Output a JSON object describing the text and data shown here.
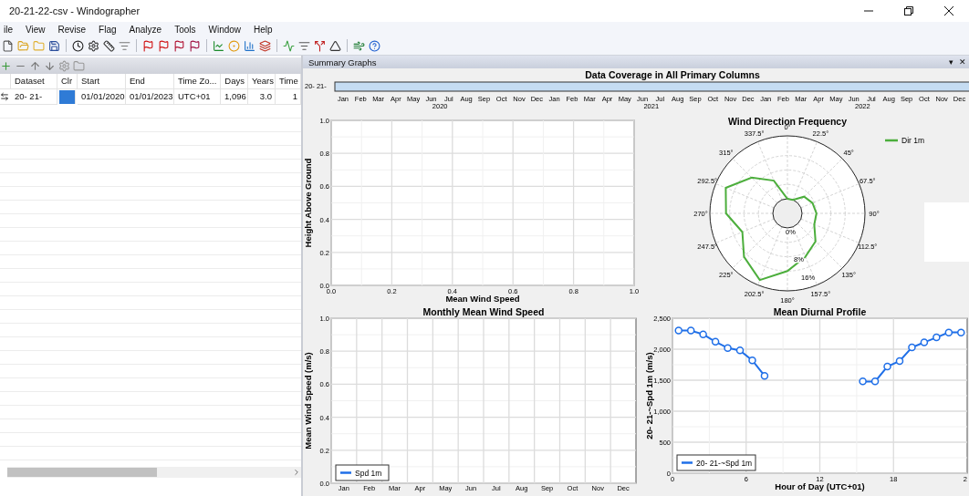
{
  "window": {
    "title": "20-21-22-csv - Windographer"
  },
  "menu": [
    "ile",
    "View",
    "Revise",
    "Flag",
    "Analyze",
    "Tools",
    "Window",
    "Help"
  ],
  "dataset_table": {
    "columns": [
      "Dataset",
      "Clr",
      "Start",
      "End",
      "Time Zo...",
      "Days",
      "Years",
      "Time"
    ],
    "rows": [
      {
        "dataset": "20- 21-",
        "color": "#2f7bd6",
        "start": "01/01/2020",
        "end": "01/01/2023",
        "time_zone": "UTC+01",
        "days": "1,096",
        "years": "3.0",
        "column_8": "1"
      }
    ]
  },
  "summary_graphs": {
    "title": "Summary Graphs",
    "controls": [
      "▾",
      "✕"
    ],
    "coverage": {
      "title": "Data Coverage in All Primary Columns",
      "rows": [
        {
          "label": "20- 21-",
          "level": 1
        }
      ],
      "months": [
        "Jan",
        "Feb",
        "Mar",
        "Apr",
        "May",
        "Jun",
        "Jul",
        "Aug",
        "Sep",
        "Oct",
        "Nov",
        "Dec",
        "Jan",
        "Feb",
        "Mar",
        "Apr",
        "May",
        "Jun",
        "Jul",
        "Aug",
        "Sep",
        "Oct",
        "Nov",
        "Dec",
        "Jan",
        "Feb",
        "Mar",
        "Apr",
        "May",
        "Jun",
        "Jul",
        "Aug",
        "Sep",
        "Oct",
        "Nov",
        "Dec"
      ],
      "years": [
        "2020",
        "2021",
        "2022"
      ]
    },
    "height_profile": {
      "chart_data": {
        "type": "line",
        "grid": true,
        "xlabel": "Mean Wind Speed",
        "ylabel": "Height Above Ground",
        "xlim": [
          0,
          1
        ],
        "ylim": [
          0,
          1
        ],
        "xticks": [
          {
            "value": 0,
            "label": "0.0"
          },
          {
            "value": 0.2,
            "label": "0.2"
          },
          {
            "value": 0.4,
            "label": "0.4"
          },
          {
            "value": 0.6,
            "label": "0.6"
          },
          {
            "value": 0.8,
            "label": "0.8"
          },
          {
            "value": 1,
            "label": "1.0"
          }
        ],
        "yticks": [
          {
            "value": 0,
            "label": "0.0"
          },
          {
            "value": 0.2,
            "label": "0.2"
          },
          {
            "value": 0.4,
            "label": "0.4"
          },
          {
            "value": 0.6,
            "label": "0.6"
          },
          {
            "value": 0.8,
            "label": "0.8"
          },
          {
            "value": 1,
            "label": "1.0"
          }
        ]
      }
    },
    "wind_direction": {
      "title": "Wind Direction Frequency",
      "directions": [
        "0°",
        "22.5°",
        "45°",
        "67.5°",
        "90°",
        "112.5°",
        "135°",
        "157.5°",
        "180°",
        "202.5°",
        "225°",
        "247.5°",
        "270°",
        "292.5°",
        "315°",
        "337.5°"
      ],
      "legend": [
        {
          "name": "Dir 1m",
          "color": "#4cae3c"
        }
      ],
      "ring_labels": [
        "0%",
        "8%",
        "16%"
      ]
    },
    "monthly": {
      "chart_data": {
        "type": "line",
        "grid": true,
        "title": "Monthly Mean Wind Speed",
        "ylabel": "Mean Wind Speed (m/s)",
        "categories": [
          "Jan",
          "Feb",
          "Mar",
          "Apr",
          "May",
          "Jun",
          "Jul",
          "Aug",
          "Sep",
          "Oct",
          "Nov",
          "Dec"
        ],
        "series": [
          {
            "name": "Spd 1m",
            "color": "#1f6fe8",
            "values": [
              null,
              null,
              null,
              null,
              null,
              null,
              null,
              null,
              null,
              null,
              null,
              null
            ]
          }
        ],
        "ylim": [
          0,
          1
        ],
        "yticks": [
          {
            "value": 0,
            "label": "0.0"
          },
          {
            "value": 0.2,
            "label": "0.2"
          },
          {
            "value": 0.4,
            "label": "0.4"
          },
          {
            "value": 0.6,
            "label": "0.6"
          },
          {
            "value": 0.8,
            "label": "0.8"
          },
          {
            "value": 1,
            "label": "1.0"
          }
        ]
      }
    },
    "diurnal": {
      "chart_data": {
        "type": "line",
        "grid": true,
        "title": "Mean Diurnal Profile",
        "xlabel": "Hour of Day (UTC+01)",
        "ylabel": "20- 21-~Spd 1m (m/s)",
        "x": [
          0.5,
          1.5,
          2.5,
          3.5,
          4.5,
          5.5,
          6.5,
          7.5,
          8.5,
          9.5,
          10.5,
          11.5,
          12.5,
          13.5,
          14.5,
          15.5,
          16.5,
          17.5,
          18.5,
          19.5,
          20.5,
          21.5,
          22.5,
          23.5
        ],
        "series": [
          {
            "name": "20- 21-~Spd 1m",
            "color": "#1f6fe8",
            "marker": true,
            "values": [
              2300,
              2300,
              2240,
              2120,
              2020,
              1980,
              1820,
              1570,
              null,
              null,
              null,
              null,
              null,
              null,
              null,
              1480,
              1480,
              1720,
              1810,
              2030,
              2110,
              2190,
              2270,
              2270
            ]
          }
        ],
        "xlim": [
          0,
          24
        ],
        "ylim": [
          0,
          2500
        ],
        "xticks": [
          {
            "value": 0,
            "label": "0"
          },
          {
            "value": 6,
            "label": "6"
          },
          {
            "value": 12,
            "label": "12"
          },
          {
            "value": 18,
            "label": "18"
          }
        ],
        "yticks": [
          {
            "value": 0,
            "label": "0"
          },
          {
            "value": 500,
            "label": "500"
          },
          {
            "value": 1000,
            "label": "1,000"
          },
          {
            "value": 1500,
            "label": "1,500"
          },
          {
            "value": 2000,
            "label": "2,000"
          },
          {
            "value": 2500,
            "label": "2,500"
          }
        ]
      },
      "edge_tick_label": "2"
    }
  }
}
